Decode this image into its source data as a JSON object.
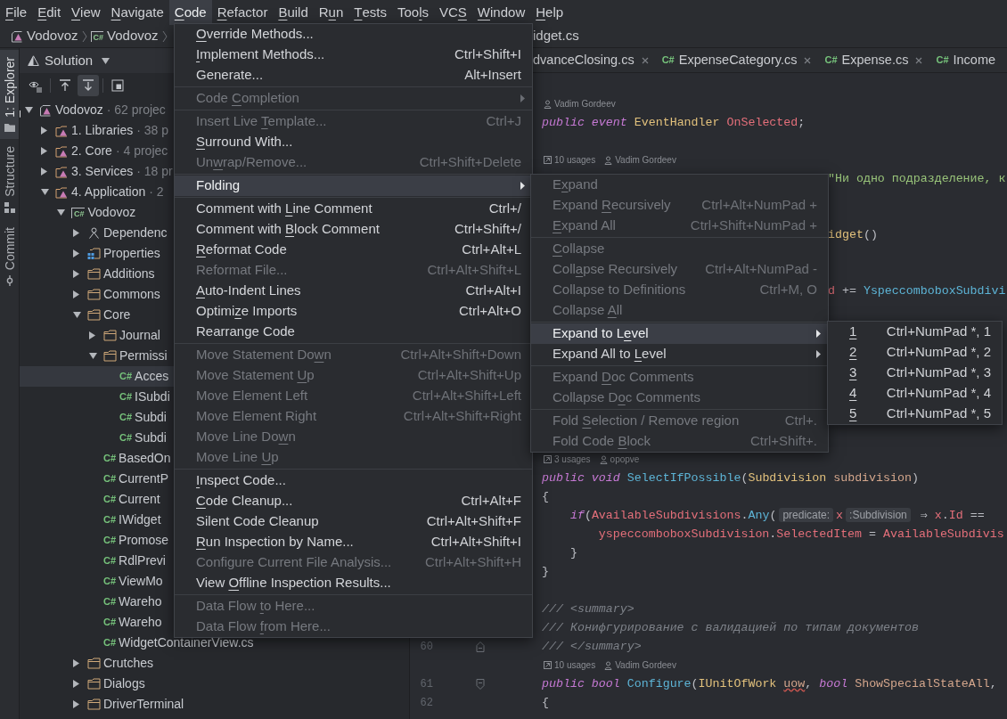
{
  "menu_bar": [
    {
      "label": [
        {
          "mnemonic": "F"
        },
        "ile"
      ],
      "selected": false
    },
    {
      "label": [
        {
          "mnemonic": "E"
        },
        "dit"
      ],
      "selected": false
    },
    {
      "label": [
        {
          "mnemonic": "V"
        },
        "iew"
      ],
      "selected": false
    },
    {
      "label": [
        {
          "mnemonic": "N"
        },
        "avigate"
      ],
      "selected": false
    },
    {
      "label": [
        {
          "mnemonic": "C"
        },
        "ode"
      ],
      "selected": true
    },
    {
      "label": [
        {
          "mnemonic": "R"
        },
        "efactor"
      ],
      "selected": false
    },
    {
      "label": [
        {
          "mnemonic": "B"
        },
        "uild"
      ],
      "selected": false
    },
    {
      "label": [
        "R",
        {
          "mnemonic": "u"
        },
        "n"
      ],
      "selected": false
    },
    {
      "label": [
        {
          "mnemonic": "T"
        },
        "ests"
      ],
      "selected": false
    },
    {
      "label": [
        "Too",
        {
          "mnemonic": "l"
        },
        "s"
      ],
      "selected": false
    },
    {
      "label": [
        "VC",
        {
          "mnemonic": "S"
        }
      ],
      "selected": false
    },
    {
      "label": [
        {
          "mnemonic": "W"
        },
        "indow"
      ],
      "selected": false
    },
    {
      "label": [
        {
          "mnemonic": "H"
        },
        "elp"
      ],
      "selected": false
    }
  ],
  "breadcrumb": [
    {
      "kind": "solution",
      "label": "Vodovoz"
    },
    {
      "kind": "project",
      "badge": "C#",
      "label": "Vodovoz"
    },
    {
      "kind": "tail",
      "label": "idget.cs"
    }
  ],
  "tool_strip": [
    {
      "kind": "explorer",
      "label": [
        {
          "mnemonic": "1"
        },
        ": Explorer"
      ],
      "selected": true
    },
    {
      "kind": "structure",
      "label": [
        "Structure"
      ],
      "selected": false
    },
    {
      "kind": "commit",
      "label": [
        "Commit"
      ],
      "selected": false
    }
  ],
  "solution_panel": {
    "title": "Solution",
    "toolbar": [
      [
        {
          "kind": "eye",
          "pressed": false
        }
      ],
      [
        {
          "kind": "arrow_up",
          "pressed": false
        },
        {
          "kind": "arrow_down",
          "pressed": true
        }
      ],
      [
        {
          "kind": "frame",
          "pressed": false
        }
      ]
    ],
    "tree": [
      {
        "kind": "solution",
        "label": "Vodovoz",
        "note": "· 62 projec",
        "expanded": true,
        "selected": false,
        "children": [
          {
            "kind": "group",
            "label": "1. Libraries",
            "note": "· 38 p",
            "expanded": false,
            "selected": false
          },
          {
            "kind": "group",
            "label": "2. Core",
            "note": "· 4 projec",
            "expanded": false,
            "selected": false
          },
          {
            "kind": "group",
            "label": "3. Services",
            "note": "· 18 pr",
            "expanded": false,
            "selected": false
          },
          {
            "kind": "group",
            "label": "4. Application",
            "note": "· 2",
            "expanded": true,
            "selected": false,
            "children": [
              {
                "kind": "project",
                "badge": "C#",
                "label": "Vodovoz",
                "expanded": true,
                "selected": false,
                "children": [
                  {
                    "kind": "dependencies",
                    "label": "Dependenc",
                    "expanded": false,
                    "selected": false
                  },
                  {
                    "kind": "properties",
                    "label": "Properties",
                    "expanded": false,
                    "selected": false
                  },
                  {
                    "kind": "folder",
                    "label": "Additions",
                    "expanded": false,
                    "selected": false
                  },
                  {
                    "kind": "folder",
                    "label": "Commons",
                    "expanded": false,
                    "selected": false
                  },
                  {
                    "kind": "folder",
                    "label": "Core",
                    "expanded": true,
                    "selected": false,
                    "children": [
                      {
                        "kind": "folder",
                        "label": "Journal",
                        "expanded": false,
                        "selected": false
                      },
                      {
                        "kind": "folder",
                        "label": "Permissi",
                        "expanded": true,
                        "selected": false,
                        "children": [
                          {
                            "kind": "file",
                            "badge": "C#",
                            "label": "Acces",
                            "selected": true
                          },
                          {
                            "kind": "file",
                            "badge": "C#",
                            "label": "ISubdi",
                            "selected": false
                          },
                          {
                            "kind": "file",
                            "badge": "C#",
                            "label": "Subdi",
                            "selected": false
                          },
                          {
                            "kind": "file",
                            "badge": "C#",
                            "label": "Subdi",
                            "selected": false
                          }
                        ]
                      },
                      {
                        "kind": "file",
                        "badge": "C#",
                        "label": "BasedOn",
                        "selected": false
                      },
                      {
                        "kind": "file",
                        "badge": "C#",
                        "label": "CurrentP",
                        "selected": false
                      },
                      {
                        "kind": "file",
                        "badge": "C#",
                        "label": "Current",
                        "selected": false
                      },
                      {
                        "kind": "file",
                        "badge": "C#",
                        "label": "IWidget",
                        "selected": false
                      },
                      {
                        "kind": "file",
                        "badge": "C#",
                        "label": "Promose",
                        "selected": false
                      },
                      {
                        "kind": "file",
                        "badge": "C#",
                        "label": "RdlPrevi",
                        "selected": false
                      },
                      {
                        "kind": "file",
                        "badge": "C#",
                        "label": "ViewMo",
                        "selected": false
                      },
                      {
                        "kind": "file",
                        "badge": "C#",
                        "label": "Wareho",
                        "selected": false
                      },
                      {
                        "kind": "file",
                        "badge": "C#",
                        "label": "Wareho",
                        "selected": false
                      },
                      {
                        "kind": "file",
                        "badge": "C#",
                        "label": "WidgetContainerView.cs",
                        "selected": false
                      }
                    ]
                  },
                  {
                    "kind": "folder",
                    "label": "Crutches",
                    "expanded": false,
                    "selected": false
                  },
                  {
                    "kind": "folder",
                    "label": "Dialogs",
                    "expanded": false,
                    "selected": false
                  },
                  {
                    "kind": "folder",
                    "label": "DriverTerminal",
                    "expanded": false,
                    "selected": false
                  }
                ]
              }
            ]
          }
        ]
      }
    ]
  },
  "editor": {
    "tabs": [
      {
        "kind": "tail",
        "label": "dvanceClosing.cs",
        "closable": true
      },
      {
        "kind": "csharp",
        "badge": "C#",
        "label": "ExpenseCategory.cs",
        "closable": true
      },
      {
        "kind": "csharp",
        "badge": "C#",
        "label": "Expense.cs",
        "closable": true
      },
      {
        "kind": "csharp",
        "badge": "C#",
        "label": "Income",
        "closable": false
      }
    ],
    "rows": [
      {
        "kind": "blank"
      },
      {
        "kind": "hint",
        "author": "Vadim Gordeev"
      },
      {
        "kind": "code",
        "tokens": [
          {
            "kind": "keyword",
            "text": "public "
          },
          {
            "kind": "keyword",
            "text": "event "
          },
          {
            "kind": "type",
            "text": "EventHandler "
          },
          {
            "kind": "field",
            "text": "OnSelected"
          },
          {
            "kind": "plain",
            "text": ";"
          }
        ]
      },
      {
        "kind": "blank"
      },
      {
        "kind": "hint",
        "usages": "10 usages",
        "author": "Vadim Gordeev"
      },
      {
        "kind": "tail",
        "tokens": [
          {
            "kind": "string",
            "text": "\"Ни одно подразделение, к"
          }
        ]
      },
      {
        "kind": "blank"
      },
      {
        "kind": "blank"
      },
      {
        "kind": "tail",
        "tokens": [
          {
            "kind": "type",
            "text": "idget"
          },
          {
            "kind": "plain",
            "text": "()"
          }
        ]
      },
      {
        "kind": "blank"
      },
      {
        "kind": "blank"
      },
      {
        "kind": "tail",
        "tokens": [
          {
            "kind": "field",
            "text": "d"
          },
          {
            "kind": "plain",
            "text": " += "
          },
          {
            "kind": "method",
            "text": "YspeccomboboxSubdivi"
          }
        ]
      },
      {
        "kind": "blank"
      },
      {
        "kind": "blank"
      },
      {
        "kind": "blank"
      },
      {
        "kind": "blank"
      },
      {
        "kind": "blank"
      },
      {
        "kind": "blank"
      },
      {
        "kind": "blank"
      },
      {
        "kind": "blank"
      },
      {
        "kind": "hint",
        "usages": "3 usages",
        "author": "opopve"
      },
      {
        "kind": "code",
        "tokens": [
          {
            "kind": "keyword",
            "text": "public void "
          },
          {
            "kind": "method",
            "text": "SelectIfPossible"
          },
          {
            "kind": "plain",
            "text": "("
          },
          {
            "kind": "type",
            "text": "Subdivision "
          },
          {
            "kind": "param",
            "text": "subdivision"
          },
          {
            "kind": "plain",
            "text": ")"
          }
        ]
      },
      {
        "kind": "code",
        "tokens": [
          {
            "kind": "plain",
            "text": "{"
          }
        ]
      },
      {
        "kind": "code",
        "tokens": [
          {
            "kind": "keyword",
            "text": "    if"
          },
          {
            "kind": "plain",
            "text": "("
          },
          {
            "kind": "field",
            "text": "AvailableSubdivisions"
          },
          {
            "kind": "plain",
            "text": "."
          },
          {
            "kind": "method",
            "text": "Any"
          },
          {
            "kind": "plain",
            "text": "("
          },
          {
            "kind": "inlay",
            "text": "predicate:"
          },
          {
            "kind": "field",
            "text": "x"
          },
          {
            "kind": "inlay",
            "text": ":Subdivision"
          },
          {
            "kind": "plain",
            "text": " ⇒ "
          },
          {
            "kind": "field",
            "text": "x"
          },
          {
            "kind": "plain",
            "text": "."
          },
          {
            "kind": "field",
            "text": "Id"
          },
          {
            "kind": "plain",
            "text": " =="
          }
        ]
      },
      {
        "kind": "code",
        "tokens": [
          {
            "kind": "field",
            "text": "        yspeccomboboxSubdivision"
          },
          {
            "kind": "plain",
            "text": "."
          },
          {
            "kind": "field",
            "text": "SelectedItem"
          },
          {
            "kind": "plain",
            "text": " = "
          },
          {
            "kind": "field",
            "text": "AvailableSubdivis"
          }
        ]
      },
      {
        "kind": "code",
        "tokens": [
          {
            "kind": "plain",
            "text": "    }"
          }
        ]
      },
      {
        "kind": "code",
        "tokens": [
          {
            "kind": "plain",
            "text": "}"
          }
        ]
      },
      {
        "kind": "blank"
      },
      {
        "kind": "code",
        "tokens": [
          {
            "kind": "comment",
            "text": "/// <summary>"
          }
        ]
      },
      {
        "kind": "code",
        "tokens": [
          {
            "kind": "comment",
            "text": "/// Конифгурирование с валидацией по типам документов"
          }
        ]
      },
      {
        "kind": "code",
        "line": "60",
        "fold": {
          "kind": "end"
        },
        "tokens": [
          {
            "kind": "comment",
            "text": "/// </summary>"
          }
        ]
      },
      {
        "kind": "hint",
        "usages": "10 usages",
        "author": "Vadim Gordeev"
      },
      {
        "kind": "code",
        "line": "61",
        "fold": {
          "kind": "start"
        },
        "tokens": [
          {
            "kind": "keyword",
            "text": "public bool "
          },
          {
            "kind": "method",
            "text": "Configure"
          },
          {
            "kind": "plain",
            "text": "("
          },
          {
            "kind": "type",
            "text": "IUnitOfWork "
          },
          {
            "kind": "warning",
            "text": "uow"
          },
          {
            "kind": "plain",
            "text": ", "
          },
          {
            "kind": "keyword",
            "text": "bool "
          },
          {
            "kind": "param",
            "text": "ShowSpecialStateAll"
          },
          {
            "kind": "plain",
            "text": ","
          }
        ]
      },
      {
        "kind": "code",
        "line": "62",
        "tokens": [
          {
            "kind": "plain",
            "text": "{"
          }
        ]
      }
    ]
  },
  "code_menu": {
    "groups": [
      [
        {
          "kind": "action",
          "label": [
            {
              "mnemonic": "O"
            },
            "verride Methods..."
          ],
          "disabled": false,
          "selected": false
        },
        {
          "kind": "action",
          "label": [
            {
              "mnemonic": "I"
            },
            "mplement Methods..."
          ],
          "shortcut": "Ctrl+Shift+I",
          "disabled": false,
          "selected": false
        },
        {
          "kind": "action",
          "label": [
            "Generate..."
          ],
          "shortcut": "Alt+Insert",
          "disabled": false,
          "selected": false
        }
      ],
      [
        {
          "kind": "submenu",
          "label": [
            "Code ",
            {
              "mnemonic": "C"
            },
            "ompletion"
          ],
          "disabled": true,
          "selected": false
        }
      ],
      [
        {
          "kind": "action",
          "label": [
            "Insert Live ",
            {
              "mnemonic": "T"
            },
            "emplate..."
          ],
          "shortcut": "Ctrl+J",
          "disabled": true,
          "selected": false
        },
        {
          "kind": "action",
          "label": [
            {
              "mnemonic": "S"
            },
            "urround With..."
          ],
          "disabled": false,
          "selected": false
        },
        {
          "kind": "action",
          "label": [
            "Un",
            {
              "mnemonic": "w"
            },
            "rap/Remove..."
          ],
          "shortcut": "Ctrl+Shift+Delete",
          "disabled": true,
          "selected": false
        }
      ],
      [
        {
          "kind": "submenu",
          "label": [
            "Folding"
          ],
          "disabled": false,
          "selected": true
        }
      ],
      [
        {
          "kind": "action",
          "label": [
            "Comment with ",
            {
              "mnemonic": "L"
            },
            "ine Comment"
          ],
          "shortcut": "Ctrl+/",
          "disabled": false,
          "selected": false
        },
        {
          "kind": "action",
          "label": [
            "Comment with ",
            {
              "mnemonic": "B"
            },
            "lock Comment"
          ],
          "shortcut": "Ctrl+Shift+/",
          "disabled": false,
          "selected": false
        },
        {
          "kind": "action",
          "label": [
            {
              "mnemonic": "R"
            },
            "eformat Code"
          ],
          "shortcut": "Ctrl+Alt+L",
          "disabled": false,
          "selected": false
        },
        {
          "kind": "action",
          "label": [
            "Reformat File..."
          ],
          "shortcut": "Ctrl+Alt+Shift+L",
          "disabled": true,
          "selected": false
        },
        {
          "kind": "action",
          "label": [
            {
              "mnemonic": "A"
            },
            "uto-Indent Lines"
          ],
          "shortcut": "Ctrl+Alt+I",
          "disabled": false,
          "selected": false
        },
        {
          "kind": "action",
          "label": [
            "Optimi",
            {
              "mnemonic": "z"
            },
            "e Imports"
          ],
          "shortcut": "Ctrl+Alt+O",
          "disabled": false,
          "selected": false
        },
        {
          "kind": "action",
          "label": [
            "Rearrange Code"
          ],
          "disabled": false,
          "selected": false
        }
      ],
      [
        {
          "kind": "action",
          "label": [
            "Move Statement Do",
            {
              "mnemonic": "w"
            },
            "n"
          ],
          "shortcut": "Ctrl+Alt+Shift+Down",
          "disabled": true,
          "selected": false
        },
        {
          "kind": "action",
          "label": [
            "Move Statement ",
            {
              "mnemonic": "U"
            },
            "p"
          ],
          "shortcut": "Ctrl+Alt+Shift+Up",
          "disabled": true,
          "selected": false
        },
        {
          "kind": "action",
          "label": [
            "Move Element Left"
          ],
          "shortcut": "Ctrl+Alt+Shift+Left",
          "disabled": true,
          "selected": false
        },
        {
          "kind": "action",
          "label": [
            "Move Element Right"
          ],
          "shortcut": "Ctrl+Alt+Shift+Right",
          "disabled": true,
          "selected": false
        },
        {
          "kind": "action",
          "label": [
            "Move Line Do",
            {
              "mnemonic": "w"
            },
            "n"
          ],
          "disabled": true,
          "selected": false
        },
        {
          "kind": "action",
          "label": [
            "Move Line ",
            {
              "mnemonic": "U"
            },
            "p"
          ],
          "disabled": true,
          "selected": false
        }
      ],
      [
        {
          "kind": "action",
          "label": [
            {
              "mnemonic": "I"
            },
            "nspect Code..."
          ],
          "disabled": false,
          "selected": false
        },
        {
          "kind": "action",
          "label": [
            {
              "mnemonic": "C"
            },
            "ode Cleanup..."
          ],
          "shortcut": "Ctrl+Alt+F",
          "disabled": false,
          "selected": false
        },
        {
          "kind": "action",
          "label": [
            "Silent Code Cleanup"
          ],
          "shortcut": "Ctrl+Alt+Shift+F",
          "disabled": false,
          "selected": false
        },
        {
          "kind": "action",
          "label": [
            {
              "mnemonic": "R"
            },
            "un Inspection by Name..."
          ],
          "shortcut": "Ctrl+Alt+Shift+I",
          "disabled": false,
          "selected": false
        },
        {
          "kind": "action",
          "label": [
            "Configure Current File Analysis..."
          ],
          "shortcut": "Ctrl+Alt+Shift+H",
          "disabled": true,
          "selected": false
        },
        {
          "kind": "action",
          "label": [
            "View ",
            {
              "mnemonic": "O"
            },
            "ffline Inspection Results..."
          ],
          "disabled": false,
          "selected": false
        }
      ],
      [
        {
          "kind": "action",
          "label": [
            "Data Flow ",
            {
              "mnemonic": "t"
            },
            "o Here..."
          ],
          "disabled": true,
          "selected": false
        },
        {
          "kind": "action",
          "label": [
            "Data Flow ",
            {
              "mnemonic": "f"
            },
            "rom Here..."
          ],
          "disabled": true,
          "selected": false
        }
      ]
    ]
  },
  "folding_menu": {
    "groups": [
      [
        {
          "kind": "action",
          "label": [
            "E",
            {
              "mnemonic": "x"
            },
            "pand"
          ],
          "disabled": true,
          "selected": false
        },
        {
          "kind": "action",
          "label": [
            "Expand ",
            {
              "mnemonic": "R"
            },
            "ecursively"
          ],
          "shortcut": "Ctrl+Alt+NumPad +",
          "disabled": true,
          "selected": false
        },
        {
          "kind": "action",
          "label": [
            {
              "mnemonic": "E"
            },
            "xpand All"
          ],
          "shortcut": "Ctrl+Shift+NumPad +",
          "disabled": true,
          "selected": false
        }
      ],
      [
        {
          "kind": "action",
          "label": [
            {
              "mnemonic": "C"
            },
            "ollapse"
          ],
          "disabled": true,
          "selected": false
        },
        {
          "kind": "action",
          "label": [
            "Coll",
            {
              "mnemonic": "a"
            },
            "pse Recursively"
          ],
          "shortcut": "Ctrl+Alt+NumPad -",
          "disabled": true,
          "selected": false
        },
        {
          "kind": "action",
          "label": [
            "Collapse to Definitions"
          ],
          "shortcut": "Ctrl+M, O",
          "disabled": true,
          "selected": false
        },
        {
          "kind": "action",
          "label": [
            "Collapse ",
            {
              "mnemonic": "A"
            },
            "ll"
          ],
          "disabled": true,
          "selected": false
        }
      ],
      [
        {
          "kind": "submenu",
          "label": [
            "Expand to L",
            {
              "mnemonic": "e"
            },
            "vel"
          ],
          "disabled": false,
          "selected": true
        },
        {
          "kind": "submenu",
          "label": [
            "Expand All to ",
            {
              "mnemonic": "L"
            },
            "evel"
          ],
          "disabled": false,
          "selected": false
        }
      ],
      [
        {
          "kind": "action",
          "label": [
            "Expand ",
            {
              "mnemonic": "D"
            },
            "oc Comments"
          ],
          "disabled": true,
          "selected": false
        },
        {
          "kind": "action",
          "label": [
            "Collapse D",
            {
              "mnemonic": "o"
            },
            "c Comments"
          ],
          "disabled": true,
          "selected": false
        }
      ],
      [
        {
          "kind": "action",
          "label": [
            "Fold ",
            {
              "mnemonic": "S"
            },
            "election / Remove region"
          ],
          "shortcut": "Ctrl+.",
          "disabled": true,
          "selected": false
        },
        {
          "kind": "action",
          "label": [
            "Fold Code ",
            {
              "mnemonic": "B"
            },
            "lock"
          ],
          "shortcut": "Ctrl+Shift+.",
          "disabled": true,
          "selected": false
        }
      ]
    ]
  },
  "level_menu": {
    "items": [
      {
        "kind": "action",
        "label": [
          {
            "mnemonic": "1"
          }
        ],
        "shortcut": "Ctrl+NumPad *, 1",
        "disabled": false,
        "selected": false
      },
      {
        "kind": "action",
        "label": [
          {
            "mnemonic": "2"
          }
        ],
        "shortcut": "Ctrl+NumPad *, 2",
        "disabled": false,
        "selected": false
      },
      {
        "kind": "action",
        "label": [
          {
            "mnemonic": "3"
          }
        ],
        "shortcut": "Ctrl+NumPad *, 3",
        "disabled": false,
        "selected": false
      },
      {
        "kind": "action",
        "label": [
          {
            "mnemonic": "4"
          }
        ],
        "shortcut": "Ctrl+NumPad *, 4",
        "disabled": false,
        "selected": false
      },
      {
        "kind": "action",
        "label": [
          {
            "mnemonic": "5"
          }
        ],
        "shortcut": "Ctrl+NumPad *, 5",
        "disabled": false,
        "selected": false
      }
    ]
  }
}
